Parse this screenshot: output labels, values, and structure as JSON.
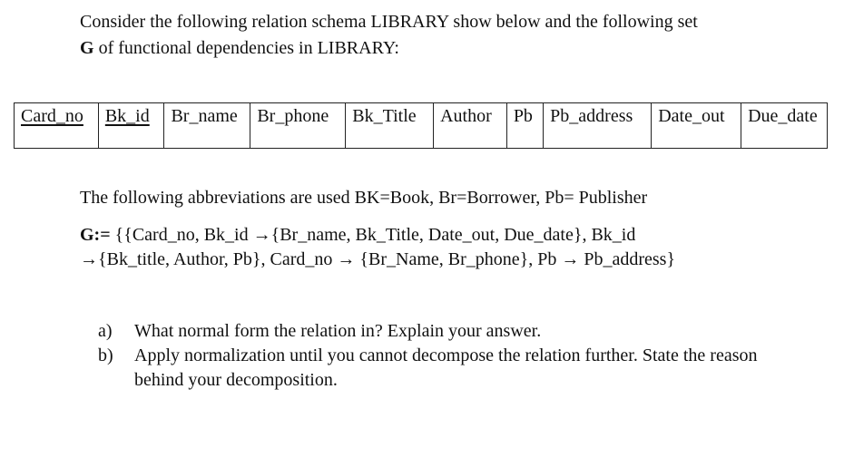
{
  "intro": {
    "line1": "Consider the following relation schema LIBRARY show below and the following set",
    "line2_bold": "G",
    "line2_rest": " of functional dependencies in LIBRARY:"
  },
  "schema": {
    "relation": "LIBRARY",
    "attributes": [
      {
        "name": "Card_no",
        "key": true
      },
      {
        "name": "Bk_id",
        "key": true
      },
      {
        "name": "Br_name",
        "key": false
      },
      {
        "name": "Br_phone",
        "key": false
      },
      {
        "name": "Bk_Title",
        "key": false
      },
      {
        "name": "Author",
        "key": false
      },
      {
        "name": "Pb",
        "key": false
      },
      {
        "name": "Pb_address",
        "key": false
      },
      {
        "name": "Date_out",
        "key": false
      },
      {
        "name": "Due_date",
        "key": false
      }
    ]
  },
  "abbreviations": "The following abbreviations are used BK=Book, Br=Borrower, Pb= Publisher",
  "fds": {
    "label": "G:=",
    "line1": " {{Card_no, Bk_id →{Br_name, Bk_Title, Date_out, Due_date}, Bk_id",
    "line2": "→{Bk_title, Author, Pb}, Card_no → {Br_Name, Br_phone}, Pb → Pb_address}"
  },
  "questions": [
    {
      "marker": "a)",
      "text": "What normal form the relation in? Explain your answer."
    },
    {
      "marker": "b)",
      "text": "Apply normalization until you cannot decompose the relation further. State the reason behind your decomposition."
    }
  ]
}
